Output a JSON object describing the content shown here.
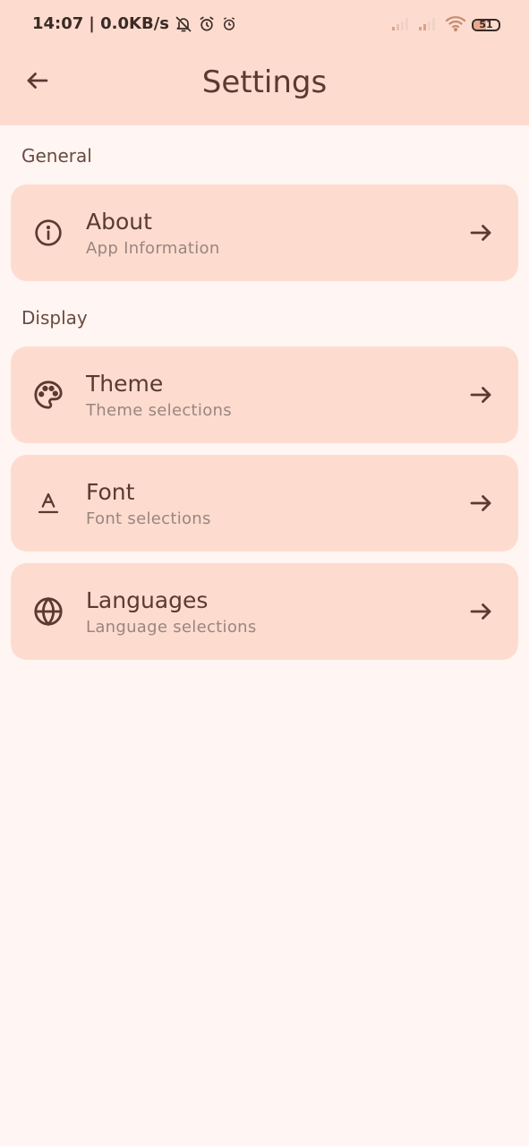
{
  "status_bar": {
    "time": "14:07",
    "network_speed": "| 0.0KB/s",
    "battery_level": "51",
    "battery_fraction": 0.51,
    "icons": [
      "bell-off-icon",
      "alarm-icon",
      "alarm-outline-icon",
      "signal-icon",
      "signal-icon",
      "wifi-icon",
      "battery-icon"
    ]
  },
  "app_bar": {
    "title": "Settings",
    "back_icon": "arrow-left-icon"
  },
  "sections": [
    {
      "label": "General",
      "items": [
        {
          "title": "About",
          "subtitle": "App Information",
          "icon": "info-icon"
        }
      ]
    },
    {
      "label": "Display",
      "items": [
        {
          "title": "Theme",
          "subtitle": "Theme selections",
          "icon": "palette-icon"
        },
        {
          "title": "Font",
          "subtitle": "Font selections",
          "icon": "font-icon"
        },
        {
          "title": "Languages",
          "subtitle": "Language selections",
          "icon": "globe-icon"
        }
      ]
    }
  ],
  "colors": {
    "background": "#FFF5F2",
    "surface": "#FDDCCF",
    "on_surface": "#5A3A31",
    "subtitle": "#9A8580"
  }
}
